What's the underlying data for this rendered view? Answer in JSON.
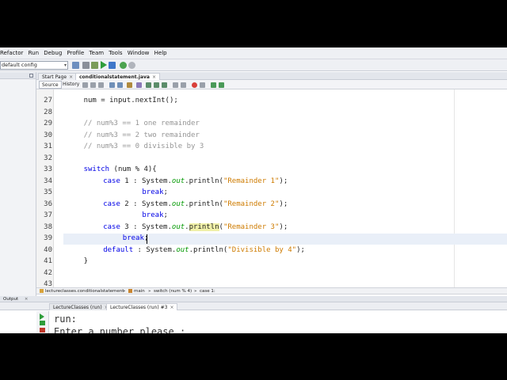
{
  "menubar": {
    "items": [
      "Refactor",
      "Run",
      "Debug",
      "Profile",
      "Team",
      "Tools",
      "Window",
      "Help"
    ]
  },
  "toolbar": {
    "config_value": "default config",
    "config_arrow": "▾"
  },
  "editor_tabs": [
    {
      "label": "Start Page",
      "close": "×"
    },
    {
      "label": "conditionalstatement.java",
      "close": "×"
    }
  ],
  "source_bar": {
    "source_label": "Source",
    "history_label": "History"
  },
  "code": {
    "lines": [
      {
        "num": "27",
        "indent": 4,
        "tokens": [
          {
            "t": "num = input.nextInt();",
            "c": ""
          }
        ]
      },
      {
        "num": "28",
        "indent": 0,
        "tokens": []
      },
      {
        "num": "29",
        "indent": 4,
        "tokens": [
          {
            "t": "// num%3 == 1 one remainder",
            "c": "cmt"
          }
        ]
      },
      {
        "num": "30",
        "indent": 4,
        "tokens": [
          {
            "t": "// num%3 == 2 two remainder",
            "c": "cmt"
          }
        ]
      },
      {
        "num": "31",
        "indent": 4,
        "tokens": [
          {
            "t": "// num%3 == 0 divisible by 3",
            "c": "cmt"
          }
        ]
      },
      {
        "num": "32",
        "indent": 0,
        "tokens": []
      },
      {
        "num": "33",
        "indent": 4,
        "tokens": [
          {
            "t": "switch",
            "c": "kw"
          },
          {
            "t": " (num % 4){",
            "c": ""
          }
        ]
      },
      {
        "num": "34",
        "indent": 8,
        "tokens": [
          {
            "t": "case",
            "c": "kw"
          },
          {
            "t": " 1 : System.",
            "c": ""
          },
          {
            "t": "out",
            "c": "it"
          },
          {
            "t": ".println(",
            "c": ""
          },
          {
            "t": "\"Remainder 1\"",
            "c": "str"
          },
          {
            "t": ");",
            "c": ""
          }
        ]
      },
      {
        "num": "35",
        "indent": 16,
        "tokens": [
          {
            "t": "break",
            "c": "kw"
          },
          {
            "t": ";",
            "c": ""
          }
        ]
      },
      {
        "num": "36",
        "indent": 8,
        "tokens": [
          {
            "t": "case",
            "c": "kw"
          },
          {
            "t": " 2 : System.",
            "c": ""
          },
          {
            "t": "out",
            "c": "it"
          },
          {
            "t": ".println(",
            "c": ""
          },
          {
            "t": "\"Remainder 2\"",
            "c": "str"
          },
          {
            "t": ");",
            "c": ""
          }
        ]
      },
      {
        "num": "37",
        "indent": 16,
        "tokens": [
          {
            "t": "break",
            "c": "kw"
          },
          {
            "t": ";",
            "c": ""
          }
        ]
      },
      {
        "num": "38",
        "indent": 8,
        "tokens": [
          {
            "t": "case",
            "c": "kw"
          },
          {
            "t": " 3 : System.",
            "c": ""
          },
          {
            "t": "out",
            "c": "it"
          },
          {
            "t": ".",
            "c": ""
          },
          {
            "t": "println",
            "c": "hl"
          },
          {
            "t": "(",
            "c": ""
          },
          {
            "t": "\"Remainder 3\"",
            "c": "str"
          },
          {
            "t": ");",
            "c": ""
          }
        ]
      },
      {
        "num": "39",
        "indent": 12,
        "tokens": [
          {
            "t": "break",
            "c": "kw"
          },
          {
            "t": ";",
            "c": ""
          }
        ]
      },
      {
        "num": "40",
        "indent": 8,
        "tokens": [
          {
            "t": "default",
            "c": "kw"
          },
          {
            "t": " : System.",
            "c": ""
          },
          {
            "t": "out",
            "c": "it"
          },
          {
            "t": ".println(",
            "c": ""
          },
          {
            "t": "\"Divisible by 4\"",
            "c": "str"
          },
          {
            "t": ");",
            "c": ""
          }
        ]
      },
      {
        "num": "41",
        "indent": 4,
        "tokens": [
          {
            "t": "}",
            "c": ""
          }
        ]
      },
      {
        "num": "42",
        "indent": 0,
        "tokens": []
      },
      {
        "num": "43",
        "indent": 0,
        "tokens": []
      }
    ]
  },
  "breadcrumb": {
    "items": [
      "lectureclasses.conditionalstatement",
      "main",
      "switch (num % 4)",
      "case 1:"
    ],
    "separator": "»"
  },
  "output": {
    "header": "Output",
    "close": "×",
    "tabs": [
      {
        "label": "LectureClasses (run)",
        "close": "×"
      },
      {
        "label": "LectureClasses (run) #3",
        "close": "×"
      }
    ],
    "lines": [
      "run:",
      "Enter a number please :"
    ]
  },
  "colors": {
    "keyword": "#0000e6",
    "string": "#ce7b00",
    "comment": "#969696",
    "static_field": "#009900",
    "highlight": "#f0f0a8"
  }
}
